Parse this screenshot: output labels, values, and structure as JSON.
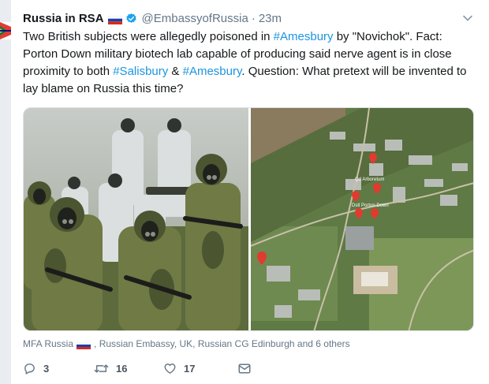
{
  "tweet": {
    "display_name": "Russia in RSA",
    "handle": "@EmbassyofRussia",
    "separator": "·",
    "time": "23m",
    "text": {
      "t1": "Two British subjects were allegedly poisoned in ",
      "tag1": "#Amesbury",
      "t2": " by \"Novichok\". Fact: Porton Down military biotech lab capable of producing said nerve agent is in close proximity to both ",
      "tag2": "#Salisbury",
      "t3": " & ",
      "tag3": "#Amesbury",
      "t4": ". Question: What pretext will be invented to lay blame on Russia this time?"
    },
    "media": {
      "map_labels": [
        "Qd Arboretum",
        "Dstl Porton Down"
      ]
    },
    "attribution": {
      "first": "MFA Russia",
      "rest": ", Russian Embassy, UK, Russian CG Edinburgh and 6 others"
    },
    "actions": {
      "replies": "3",
      "retweets": "16",
      "likes": "17"
    },
    "colors": {
      "link": "#1b95e0",
      "muted": "#657786",
      "verified": "#1da1f2"
    },
    "icons": [
      "flag-russia-icon",
      "verified-badge-icon",
      "chevron-down-icon",
      "reply-icon",
      "retweet-icon",
      "like-icon",
      "direct-message-icon"
    ]
  }
}
